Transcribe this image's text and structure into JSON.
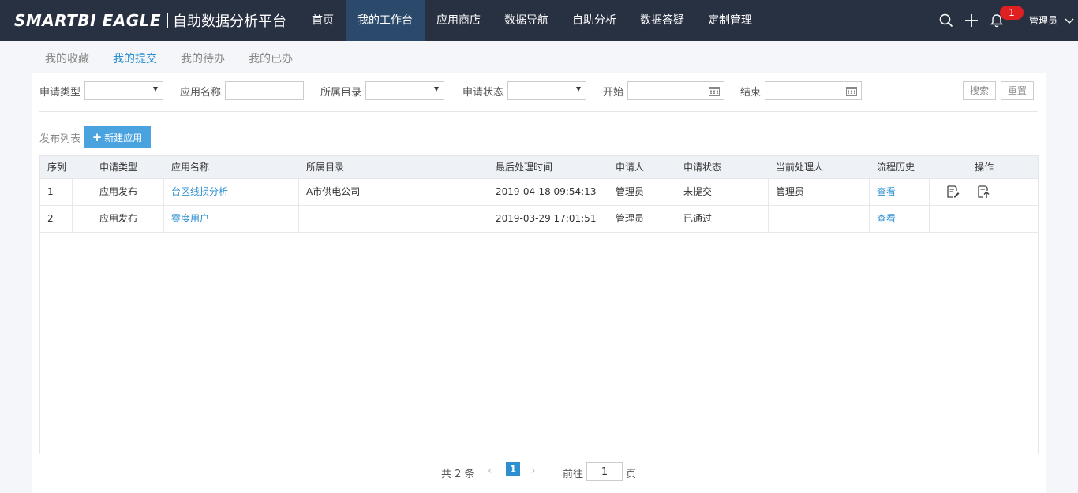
{
  "header": {
    "logo": "SMARTBI EAGLE",
    "subtitle": "自助数据分析平台",
    "nav": [
      "首页",
      "我的工作台",
      "应用商店",
      "数据导航",
      "自助分析",
      "数据答疑",
      "定制管理"
    ],
    "active_nav": "我的工作台",
    "notification_count": "1",
    "user": "管理员"
  },
  "subtabs": [
    "我的收藏",
    "我的提交",
    "我的待办",
    "我的已办"
  ],
  "active_subtab": "我的提交",
  "filters": {
    "type_label": "申请类型",
    "name_label": "应用名称",
    "dir_label": "所属目录",
    "status_label": "申请状态",
    "start_label": "开始",
    "end_label": "结束",
    "search_btn": "搜索",
    "reset_btn": "重置"
  },
  "list": {
    "label": "发布列表",
    "new_btn": "新建应用"
  },
  "table": {
    "columns": [
      "序列",
      "申请类型",
      "应用名称",
      "所属目录",
      "最后处理时间",
      "申请人",
      "申请状态",
      "当前处理人",
      "流程历史",
      "操作"
    ],
    "rows": [
      {
        "seq": "1",
        "type": "应用发布",
        "name": "台区线损分析",
        "dir": "A市供电公司",
        "time": "2019-04-18 09:54:13",
        "applicant": "管理员",
        "status": "未提交",
        "handler": "管理员",
        "history": "查看"
      },
      {
        "seq": "2",
        "type": "应用发布",
        "name": "零度用户",
        "dir": "",
        "time": "2019-03-29 17:01:51",
        "applicant": "管理员",
        "status": "已通过",
        "handler": "",
        "history": "查看"
      }
    ]
  },
  "pagination": {
    "total": "共 2 条",
    "current": "1",
    "goto_label": "前往",
    "goto_value": "1",
    "page_label": "页"
  }
}
